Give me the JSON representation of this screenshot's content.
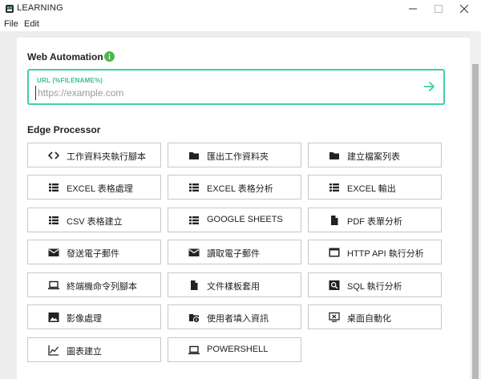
{
  "window": {
    "title": "LEARNING"
  },
  "menu": {
    "file": "File",
    "edit": "Edit"
  },
  "web_automation": {
    "title": "Web Automation",
    "url_label": "URL (%FILENAME%)",
    "url_placeholder": "https://example.com",
    "url_value": ""
  },
  "edge_processor": {
    "title": "Edge Processor",
    "tiles": [
      {
        "label": "工作資料夾執行腳本",
        "icon": "code-icon"
      },
      {
        "label": "匯出工作資料夾",
        "icon": "folder-icon"
      },
      {
        "label": "建立檔案列表",
        "icon": "folder-icon"
      },
      {
        "label": "EXCEL 表格處理",
        "icon": "table-icon"
      },
      {
        "label": "EXCEL 表格分析",
        "icon": "table-icon"
      },
      {
        "label": "EXCEL 輸出",
        "icon": "table-icon"
      },
      {
        "label": "CSV 表格建立",
        "icon": "table-icon"
      },
      {
        "label": "GOOGLE SHEETS",
        "icon": "table-icon"
      },
      {
        "label": "PDF 表單分析",
        "icon": "file-icon"
      },
      {
        "label": "發送電子郵件",
        "icon": "mail-icon"
      },
      {
        "label": "讀取電子郵件",
        "icon": "mail-icon"
      },
      {
        "label": "HTTP API 執行分析",
        "icon": "browser-window-icon"
      },
      {
        "label": "終端機命令列腳本",
        "icon": "laptop-icon"
      },
      {
        "label": "文件樣板套用",
        "icon": "file-icon"
      },
      {
        "label": "SQL 執行分析",
        "icon": "search-icon"
      },
      {
        "label": "影像處理",
        "icon": "image-icon"
      },
      {
        "label": "使用者填入資訊",
        "icon": "folder-info-icon"
      },
      {
        "label": "桌面自動化",
        "icon": "desktop-icon"
      },
      {
        "label": "圖表建立",
        "icon": "line-chart-icon"
      },
      {
        "label": "POWERSHELL",
        "icon": "laptop-icon"
      }
    ]
  },
  "colors": {
    "accent": "#3ed19b",
    "background": "#ededed",
    "card": "#ffffff",
    "tile_border": "#c8c8c8"
  }
}
